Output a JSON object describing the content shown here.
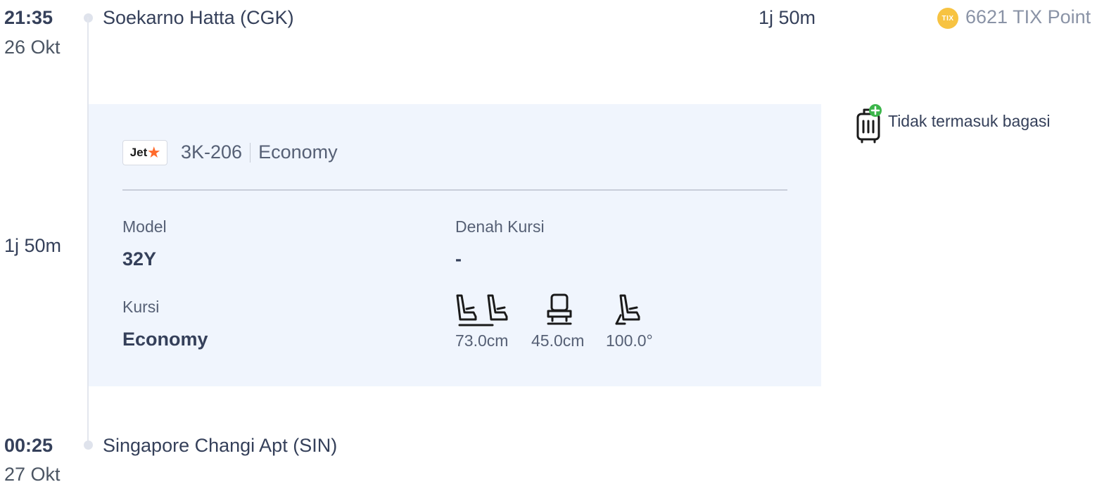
{
  "departure": {
    "time": "21:35",
    "date": "26 Okt",
    "airport": "Soekarno Hatta (CGK)",
    "duration": "1j 50m"
  },
  "points": {
    "coin_label": "TIX",
    "text": "6621 TIX Point"
  },
  "timeline": {
    "duration": "1j 50m"
  },
  "flight": {
    "airline_logo_text": "Jet",
    "number": "3K-206",
    "cabin": "Economy",
    "model_label": "Model",
    "model_value": "32Y",
    "seatmap_label": "Denah Kursi",
    "seatmap_value": "-",
    "seat_label": "Kursi",
    "seat_value": "Economy",
    "seat_specs": [
      {
        "icon": "seat-pitch-icon",
        "value": "73.0cm"
      },
      {
        "icon": "seat-width-icon",
        "value": "45.0cm"
      },
      {
        "icon": "seat-recline-icon",
        "value": "100.0°"
      }
    ]
  },
  "baggage": {
    "icon": "luggage-add-icon",
    "text": "Tidak termasuk bagasi"
  },
  "arrival": {
    "time": "00:25",
    "date": "27 Okt",
    "airport": "Singapore Changi Apt (SIN)"
  },
  "colors": {
    "card_bg": "#f0f5fd",
    "tix_coin": "#f7c342",
    "luggage_plus": "#3cb54a",
    "jetstar_star": "#ff6a2b"
  }
}
